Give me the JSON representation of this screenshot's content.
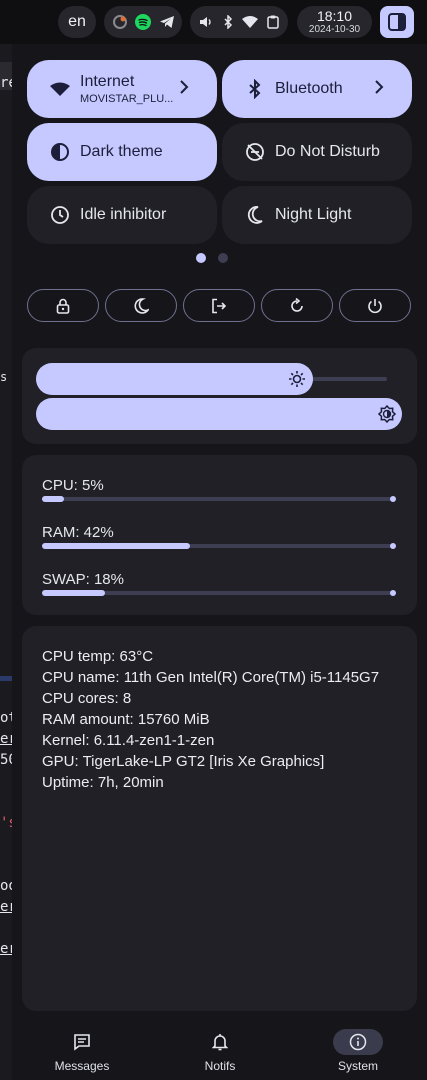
{
  "topbar": {
    "language": "en",
    "clock_time": "18:10",
    "clock_date": "2024-10-30",
    "tray_icons": [
      "app-icon",
      "spotify-icon",
      "telegram-icon"
    ],
    "status_icons": [
      "volume-icon",
      "bluetooth-icon",
      "wifi-icon",
      "clipboard-icon"
    ]
  },
  "background": {
    "snippets": [
      {
        "text": "re",
        "color": "#9aa0b0"
      },
      {
        "text": "s",
        "color": "#c8c8d0"
      },
      {
        "text": "ot",
        "color": "#d8d8e0"
      },
      {
        "text": "er",
        "color": "#d8d8e0"
      },
      {
        "text": "50",
        "color": "#d8d8e0"
      },
      {
        "text": "'s",
        "color": "#e05a6a"
      },
      {
        "text": "oo",
        "color": "#d8d8e0"
      },
      {
        "text": "er",
        "color": "#d8d8e0"
      },
      {
        "text": "er",
        "color": "#d8d8e0"
      }
    ]
  },
  "quick_settings": {
    "internet": {
      "label": "Internet",
      "sub": "MOVISTAR_PLU..."
    },
    "bluetooth": {
      "label": "Bluetooth"
    },
    "dark_theme": {
      "label": "Dark theme"
    },
    "dnd": {
      "label": "Do Not Disturb"
    },
    "idle": {
      "label": "Idle inhibitor"
    },
    "night": {
      "label": "Night Light"
    },
    "page": 1,
    "page_count": 2
  },
  "power_buttons": [
    "lock-icon",
    "moon-icon",
    "logout-icon",
    "restart-icon",
    "power-icon"
  ],
  "sliders": {
    "volume_level": 0.79,
    "brightness_level": 1.0
  },
  "stats": {
    "cpu": {
      "label": "CPU: 5%",
      "value": 0.05
    },
    "ram": {
      "label": "RAM: 42%",
      "value": 0.42
    },
    "swap": {
      "label": "SWAP: 18%",
      "value": 0.18
    }
  },
  "info": {
    "cpu_temp": "CPU temp: 63°C",
    "cpu_name": "CPU name: 11th Gen Intel(R) Core(TM) i5-1145G7",
    "cpu_cores": "CPU cores: 8",
    "ram_amount": "RAM amount: 15760 MiB",
    "kernel": "Kernel: 6.11.4-zen1-1-zen",
    "gpu": "GPU: TigerLake-LP GT2 [Iris Xe Graphics]",
    "uptime": "Uptime: 7h, 20min"
  },
  "nav": {
    "messages": "Messages",
    "notifs": "Notifs",
    "system": "System",
    "active": "system"
  },
  "colors": {
    "accent": "#c6c9ff",
    "panel": "#15151a",
    "card": "#202026"
  }
}
